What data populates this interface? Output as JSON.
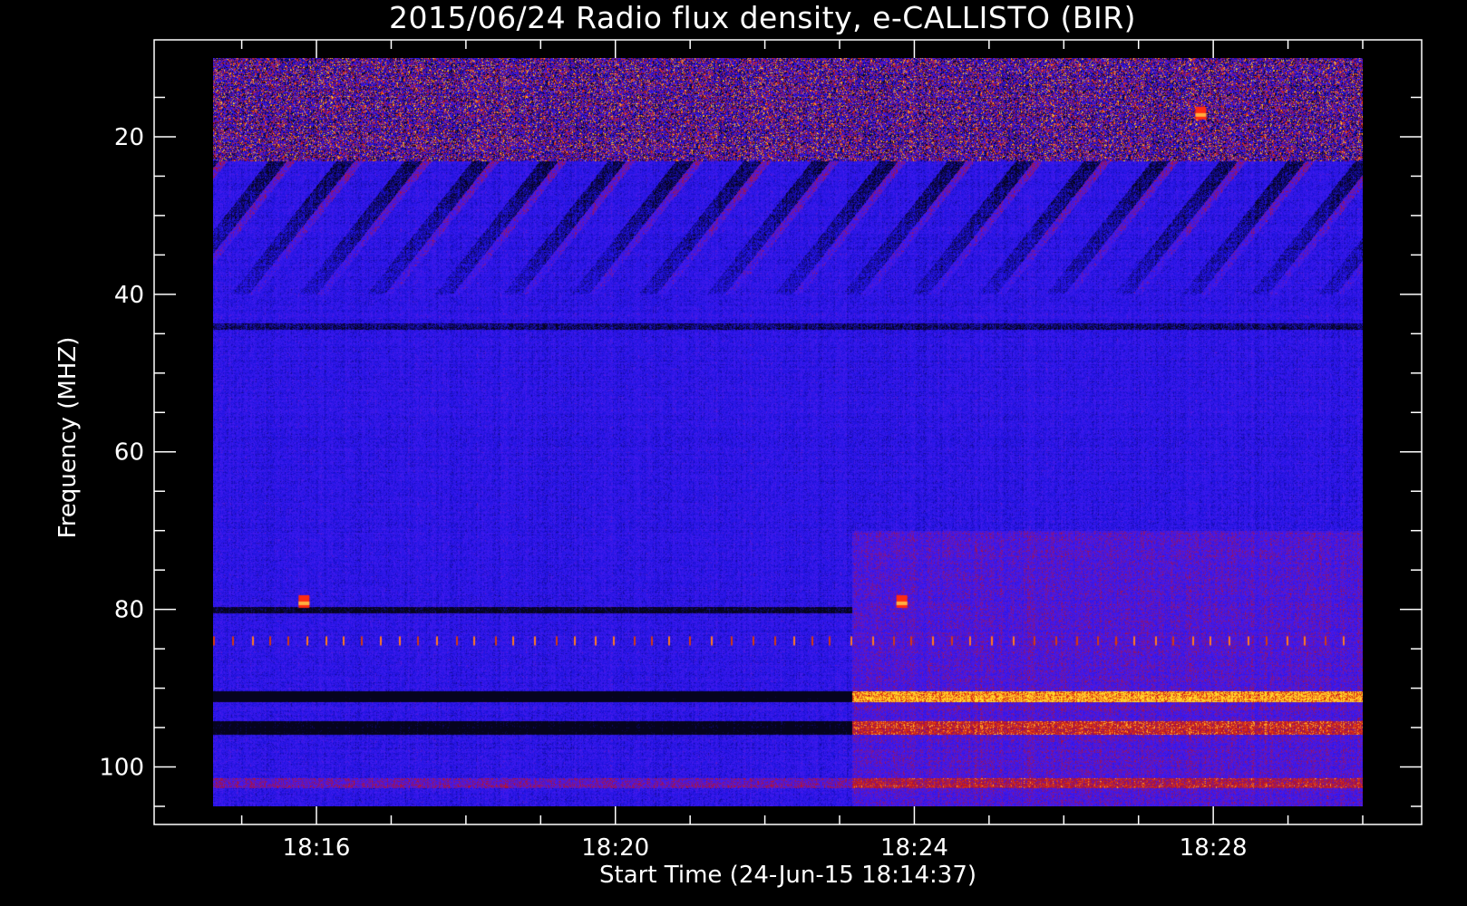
{
  "chart_data": {
    "type": "heatmap",
    "title": "2015/06/24  Radio flux density, e-CALLISTO (BIR)",
    "xlabel": "Start Time (24-Jun-15 18:14:37)",
    "ylabel": "Frequency (MHZ)",
    "x_ticks": [
      "18:16",
      "18:20",
      "18:24",
      "18:28"
    ],
    "y_ticks": [
      20,
      40,
      60,
      80,
      100
    ],
    "xlim": [
      "18:14:37",
      "18:30:00"
    ],
    "ylim": [
      105,
      10
    ],
    "colors": {
      "background": "#000000",
      "base": "#2a1aee",
      "dark": "#05031e",
      "red": "#c8200e",
      "orange": "#ff8a1a",
      "yellow": "#ffe060",
      "axis": "#ffffff"
    },
    "features": [
      {
        "kind": "rfi_band",
        "fmin": 10,
        "fmax": 23,
        "desc": "strong interference"
      },
      {
        "kind": "drifting_stripes",
        "fmin": 23,
        "fmax": 40
      },
      {
        "kind": "hot_spot",
        "time": "18:15:50",
        "freq": 79
      },
      {
        "kind": "hot_spot",
        "time": "18:23:50",
        "freq": 79
      },
      {
        "kind": "hot_spot",
        "time": "18:27:50",
        "freq": 17
      },
      {
        "kind": "periodic_line",
        "freq": 84
      },
      {
        "kind": "dark_band",
        "freq": 91
      },
      {
        "kind": "dark_band",
        "freq": 95
      },
      {
        "kind": "level_change",
        "time": "18:23:10"
      }
    ]
  }
}
